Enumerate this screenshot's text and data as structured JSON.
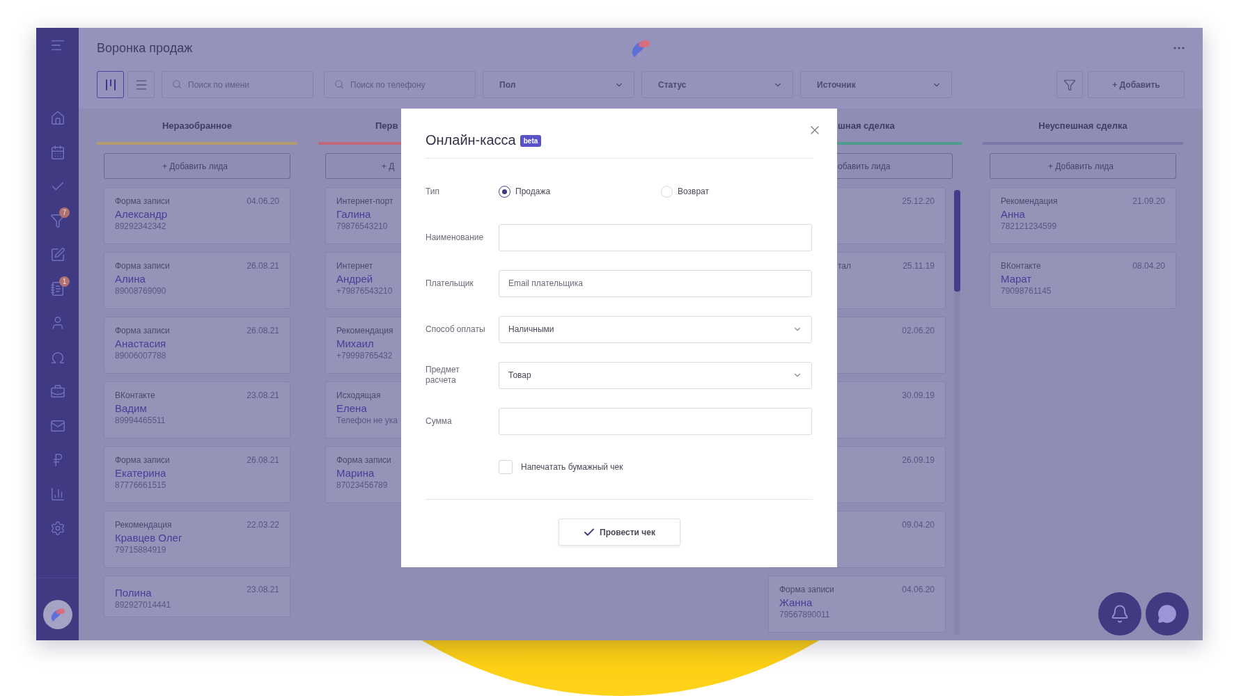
{
  "header": {
    "title": "Воронка продаж"
  },
  "sidebar": {
    "badges": [
      "7",
      "1"
    ]
  },
  "toolbar": {
    "views": [
      {
        "selected": true
      },
      {
        "selected": false
      }
    ],
    "searches": [
      {
        "placeholder": "Поиск по имени"
      },
      {
        "placeholder": "Поиск по телефону"
      }
    ],
    "filters": [
      {
        "label": "Пол"
      },
      {
        "label": "Статус"
      },
      {
        "label": "Источник"
      }
    ],
    "add_button": "+ Добавить"
  },
  "columns": [
    {
      "title": "Неразобранное",
      "color": "#b39a6e",
      "kind": "full",
      "add_label": "+ Добавить лида",
      "cards": [
        {
          "source": "Форма записи",
          "date": "04.06.20",
          "name": "Александр",
          "phone": "89292342342"
        },
        {
          "source": "Форма записи",
          "date": "26.08.21",
          "name": "Алина",
          "phone": "89008769090"
        },
        {
          "source": "Форма записи",
          "date": "26.08.21",
          "name": "Анастасия",
          "phone": "89006007788"
        },
        {
          "source": "ВКонтакте",
          "date": "23.08.21",
          "name": "Вадим",
          "phone": "89994465511"
        },
        {
          "source": "Форма записи",
          "date": "26.08.21",
          "name": "Екатерина",
          "phone": "87776661515"
        },
        {
          "source": "Рекомендация",
          "date": "22.03.22",
          "name": "Кравцев Олег",
          "phone": "79715884919"
        },
        {
          "date": "23.08.21",
          "name": "Полина",
          "phone": "892927014441"
        }
      ]
    },
    {
      "title": "Перв",
      "color": "#c0677a",
      "kind": "cut-right",
      "add_label": "+ Д",
      "cards": [
        {
          "source": "Интернет-порт",
          "name": "Галина",
          "phone": "79876543210"
        },
        {
          "source": "Интернет",
          "name": "Андрей",
          "phone": "+79876543210"
        },
        {
          "source": "Рекомендация",
          "name": "Михаил",
          "phone": "+79998765432"
        },
        {
          "source": "Исходящая",
          "name": "Елена",
          "phone": "Телефон не ука"
        },
        {
          "source": "Форма записи",
          "name": "Марина",
          "phone": "87023456789"
        }
      ]
    },
    {
      "title": "шная сделка",
      "color": "#4f9c8c",
      "kind": "cut-left",
      "add_label": "обавить лида",
      "cards": [
        {
          "kind": "partial",
          "date": "25.12.20"
        },
        {
          "kind": "partial",
          "source": "тал",
          "date": "25.11.19"
        },
        {
          "kind": "partial",
          "date": "02.06.20"
        },
        {
          "kind": "partial",
          "date": "30.09.19"
        },
        {
          "kind": "partial",
          "date": "26.09.19"
        },
        {
          "kind": "partial",
          "date": "09.04.20"
        },
        {
          "kind": "full",
          "source": "Форма записи",
          "date": "04.06.20",
          "name": "Жанна",
          "phone": "79567890011"
        }
      ]
    },
    {
      "title": "Неуспешная сделка",
      "color": "#7b79a6",
      "kind": "full",
      "add_label": "+ Добавить лида",
      "cards": [
        {
          "source": "Рекомендация",
          "date": "21.09.20",
          "name": "Анна",
          "phone": "782121234599"
        },
        {
          "source": "ВКонтакте",
          "date": "08.04.20",
          "name": "Марат",
          "phone": "79098761145"
        }
      ]
    }
  ],
  "dialog": {
    "title": "Онлайн-касса",
    "badge": "beta",
    "type_label": "Тип",
    "type_options": [
      {
        "label": "Продажа",
        "selected": true
      },
      {
        "label": "Возврат",
        "selected": false
      }
    ],
    "fields": [
      {
        "label": "Наименование",
        "kind": "text"
      },
      {
        "label": "Плательщик",
        "kind": "text",
        "placeholder": "Email плательщика"
      },
      {
        "label": "Способ оплаты",
        "kind": "select",
        "value": "Наличными"
      },
      {
        "label": "Предмет расчета",
        "kind": "select",
        "value": "Товар"
      },
      {
        "label": "Сумма",
        "kind": "text"
      }
    ],
    "print_receipt": {
      "label": "Напечатать бумажный чек",
      "checked": false
    },
    "submit": "Провести чек"
  }
}
